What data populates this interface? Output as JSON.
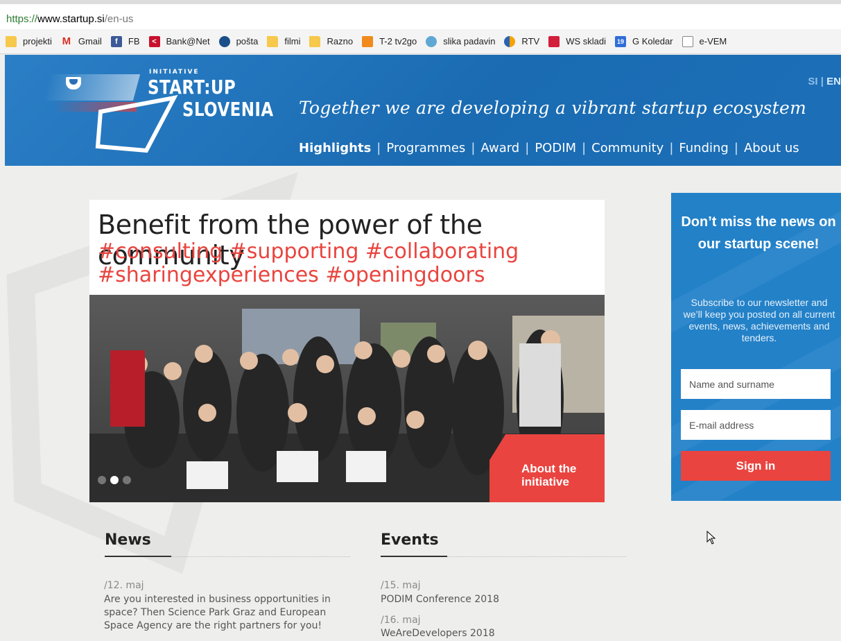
{
  "browser": {
    "url_scheme": "https://",
    "url_host": "www.startup.si",
    "url_path": "/en-us",
    "bookmarks": [
      {
        "label": "projekti",
        "icon": "folder-icon"
      },
      {
        "label": "Gmail",
        "icon": "gmail-icon"
      },
      {
        "label": "FB",
        "icon": "facebook-icon"
      },
      {
        "label": "Bank@Net",
        "icon": "bank-icon"
      },
      {
        "label": "pošta",
        "icon": "posta-icon"
      },
      {
        "label": "filmi",
        "icon": "folder-icon"
      },
      {
        "label": "Razno",
        "icon": "folder-icon"
      },
      {
        "label": "T-2 tv2go",
        "icon": "tv-icon"
      },
      {
        "label": "slika padavin",
        "icon": "weather-icon"
      },
      {
        "label": "RTV",
        "icon": "rtv-icon"
      },
      {
        "label": "WS skladi",
        "icon": "ws-icon"
      },
      {
        "label": "G Koledar",
        "icon": "calendar-icon"
      },
      {
        "label": "e-VEM",
        "icon": "document-icon"
      }
    ],
    "calendar_icon_text": "19"
  },
  "header": {
    "logo_initiative": "INITIATIVE",
    "logo_startup": "START:UP",
    "logo_slovenia": "SLOVENIA",
    "lang_si": "SI",
    "lang_sep": "|",
    "lang_en": "EN",
    "tagline": "Together we are developing a vibrant startup ecosystem",
    "nav": [
      "Highlights",
      "Programmes",
      "Award",
      "PODIM",
      "Community",
      "Funding",
      "About us"
    ],
    "nav_sep": "|"
  },
  "hero": {
    "title": "Benefit from the power of the community",
    "tags": "#consulting #supporting #collaborating #sharingexperiences #openingdoors",
    "badge": "About the initiative",
    "active_slide": 2,
    "slide_count": 3
  },
  "newsletter": {
    "title": "Don’t miss the news on our startup scene!",
    "text": "Subscribe to our newsletter and we’ll keep you posted on all current events, news, achievements and tenders.",
    "name_placeholder": "Name and surname",
    "email_placeholder": "E-mail address",
    "button": "Sign in"
  },
  "news": {
    "heading": "News",
    "items": [
      {
        "date": "/12. maj",
        "text": "Are you interested in business opportunities in space? Then Science Park Graz and European Space Agency are the right partners for you!"
      }
    ]
  },
  "events": {
    "heading": "Events",
    "items": [
      {
        "date": "/15. maj",
        "text": "PODIM Conference 2018"
      },
      {
        "date": "/16. maj",
        "text": "WeAreDevelopers 2018"
      }
    ]
  },
  "colors": {
    "header_blue": "#1c6fb7",
    "accent_red": "#ea4440",
    "newsletter_blue": "#2381c8"
  }
}
